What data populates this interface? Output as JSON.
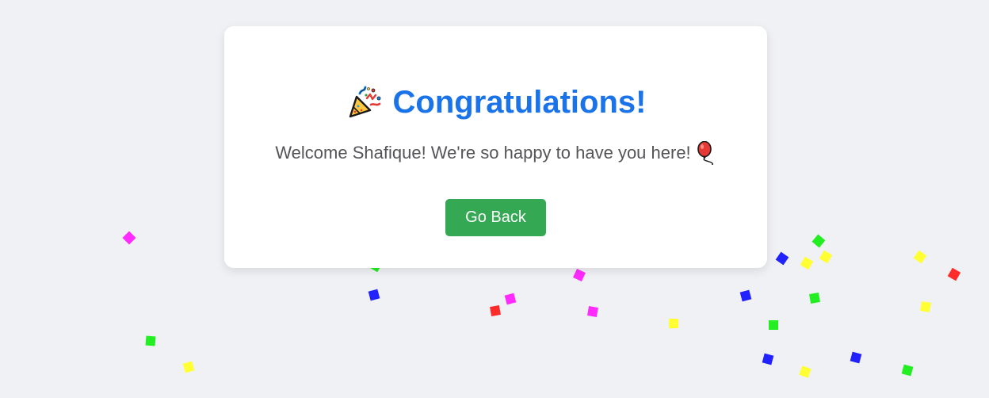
{
  "card": {
    "title": "Congratulations!",
    "subtitle": "Welcome Shafique! We're so happy to have you here!",
    "title_icon": "party-popper-icon",
    "subtitle_icon": "balloon-icon",
    "button_label": "Go Back",
    "title_color": "#1a73e8",
    "button_color": "#34a853"
  },
  "confetti_colors": {
    "magenta": "#ff2bff",
    "green": "#22ee22",
    "blue": "#2222ff",
    "yellow": "#ffff33",
    "red": "#ff2a2a"
  }
}
